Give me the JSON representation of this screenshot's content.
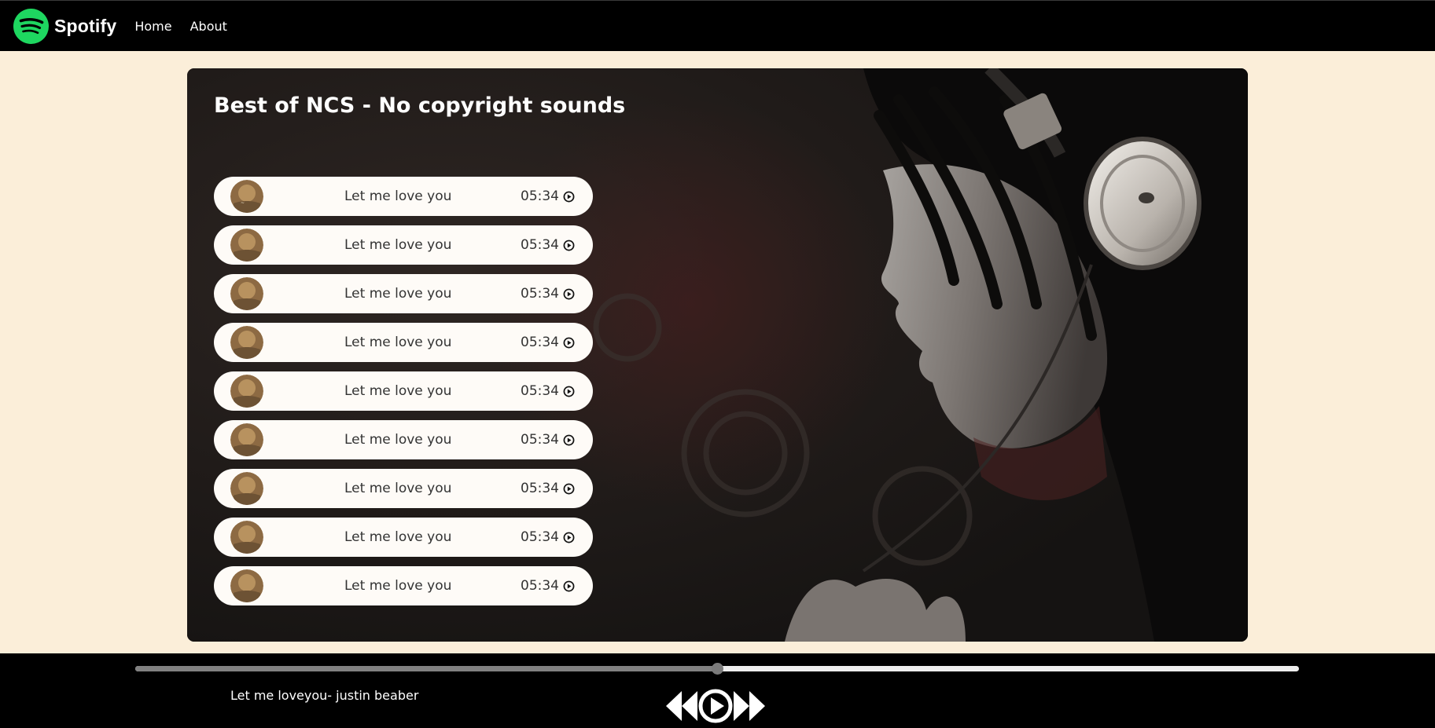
{
  "nav": {
    "brand": "Spotify",
    "links": [
      "Home",
      "About"
    ]
  },
  "playlist": {
    "title": "Best of NCS - No copyright sounds",
    "songs": [
      {
        "name": "Let me love you",
        "duration": "05:34"
      },
      {
        "name": "Let me love you",
        "duration": "05:34"
      },
      {
        "name": "Let me love you",
        "duration": "05:34"
      },
      {
        "name": "Let me love you",
        "duration": "05:34"
      },
      {
        "name": "Let me love you",
        "duration": "05:34"
      },
      {
        "name": "Let me love you",
        "duration": "05:34"
      },
      {
        "name": "Let me love you",
        "duration": "05:34"
      },
      {
        "name": "Let me love you",
        "duration": "05:34"
      },
      {
        "name": "Let me love you",
        "duration": "05:34"
      }
    ]
  },
  "player": {
    "now_playing": "Let me loveyou- justin beaber",
    "progress_percent": 50,
    "icons": {
      "previous": "backward-icon",
      "play": "play-circle-icon",
      "next": "forward-icon"
    }
  },
  "colors": {
    "brand_green": "#1ed760",
    "page_bg": "#fbeed9",
    "bar_bg": "#000000"
  }
}
